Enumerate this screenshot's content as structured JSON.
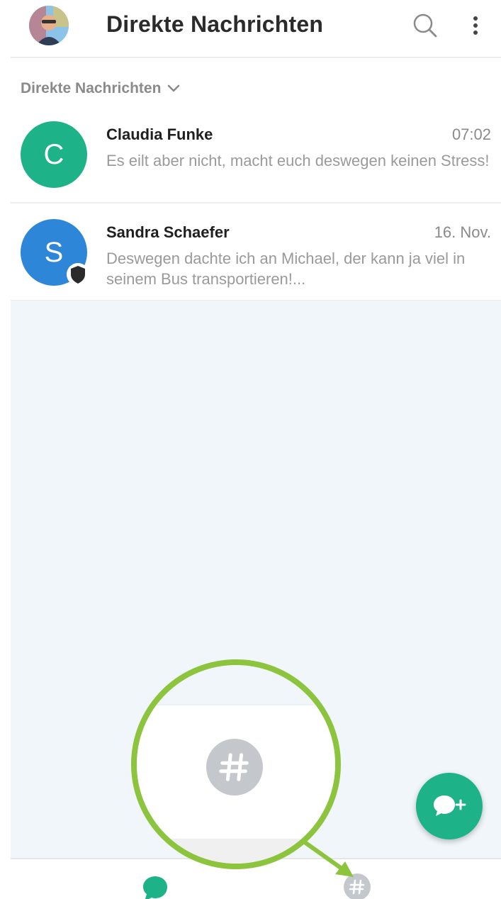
{
  "header": {
    "title": "Direkte Nachrichten",
    "avatar_icon": "user-avatar-photo",
    "search_icon": "search-icon",
    "menu_icon": "more-vertical-icon"
  },
  "section": {
    "label": "Direkte Nachrichten",
    "icon": "chevron-down-icon"
  },
  "chats": [
    {
      "initial": "C",
      "name": "Claudia Funke",
      "time": "07:02",
      "preview": "Es eilt aber nicht, macht euch deswegen keinen Stress!",
      "avatar_color": "#1db287"
    },
    {
      "initial": "S",
      "name": "Sandra Schaefer",
      "time": "16. Nov.",
      "preview": "Deswegen dachte ich an Michael, der kann ja viel in seinem Bus transportieren!...",
      "avatar_color": "#2d86d8",
      "badge_icon": "shield-icon"
    }
  ],
  "fab": {
    "icon": "new-chat-icon",
    "color": "#1db287"
  },
  "bottom_nav": {
    "items": [
      {
        "icon": "chat-bubble-icon",
        "active": true,
        "color": "#1db287"
      },
      {
        "icon": "hashtag-icon",
        "active": false,
        "color": "#c4c8cd"
      }
    ]
  },
  "callout": {
    "highlight_color": "#8cc43e",
    "icon": "hashtag-icon"
  }
}
